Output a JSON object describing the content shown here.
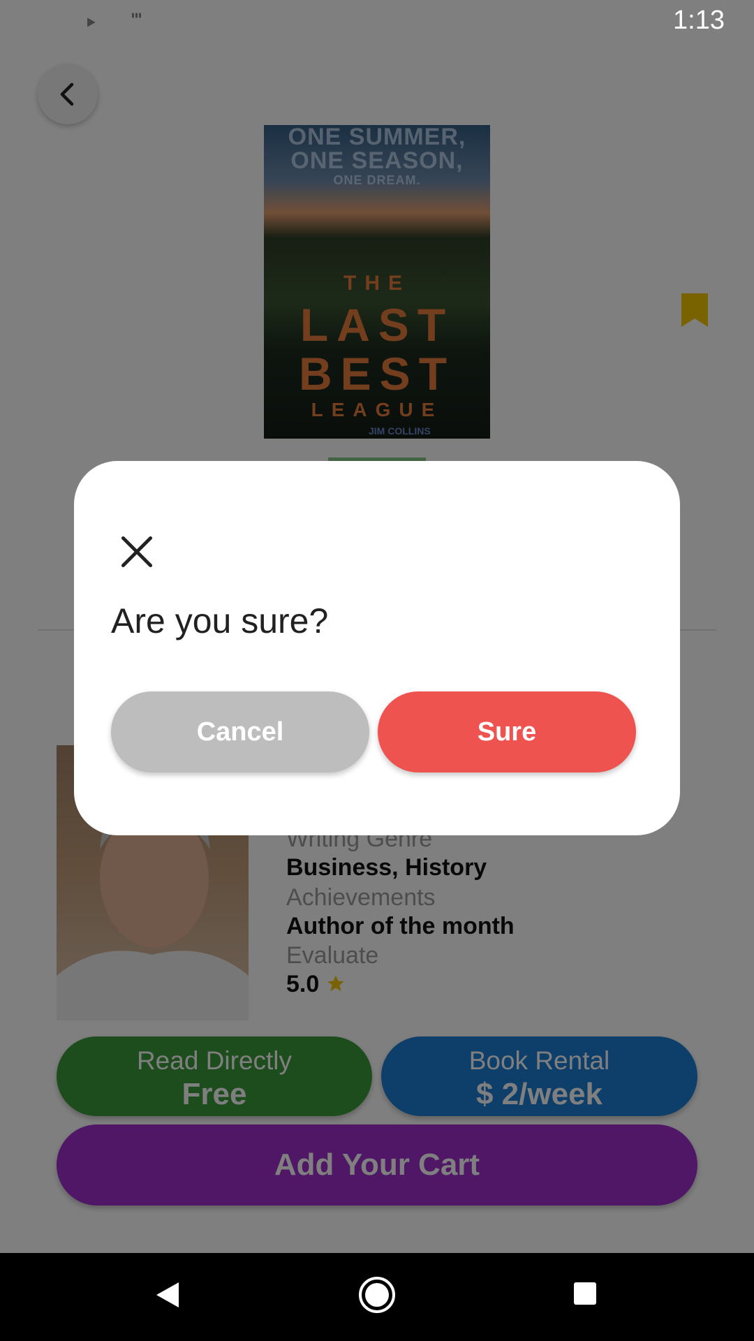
{
  "status_bar": {
    "time": "1:13",
    "left_icons": [
      "settings-icon",
      "shield-icon",
      "sd-card-icon",
      "loading-icon"
    ],
    "right_icons": [
      "wifi-icon",
      "signal-icon",
      "battery-icon"
    ]
  },
  "book": {
    "cover_tagline": [
      "ONE SUMMER,",
      "ONE SEASON,",
      "ONE DREAM."
    ],
    "cover_title": [
      "THE",
      "LAST",
      "BEST",
      "LEAGUE"
    ],
    "cover_author": "JIM COLLINS"
  },
  "author": {
    "rows": [
      {
        "label": "Writing Genre",
        "value": "Business, History"
      },
      {
        "label": "Achievements",
        "value": "Author of the month"
      },
      {
        "label": "Evaluate",
        "value": "5.0"
      }
    ],
    "rating_icon": "star-icon"
  },
  "actions": {
    "read": {
      "line1": "Read Directly",
      "line2": "Free",
      "color": "#3a9a3a"
    },
    "rental": {
      "line1": "Book Rental",
      "line2": "$ 2/week",
      "color": "#1d7fd6"
    },
    "cart": {
      "label": "Add Your Cart",
      "color": "#a02ecf"
    }
  },
  "dialog": {
    "message": "Are you sure?",
    "cancel_label": "Cancel",
    "confirm_label": "Sure",
    "cancel_color": "#bdbdbd",
    "confirm_color": "#ef5350"
  },
  "colors": {
    "bookmark": "#f2c700",
    "scrim": "rgba(0,0,0,0.5)"
  }
}
